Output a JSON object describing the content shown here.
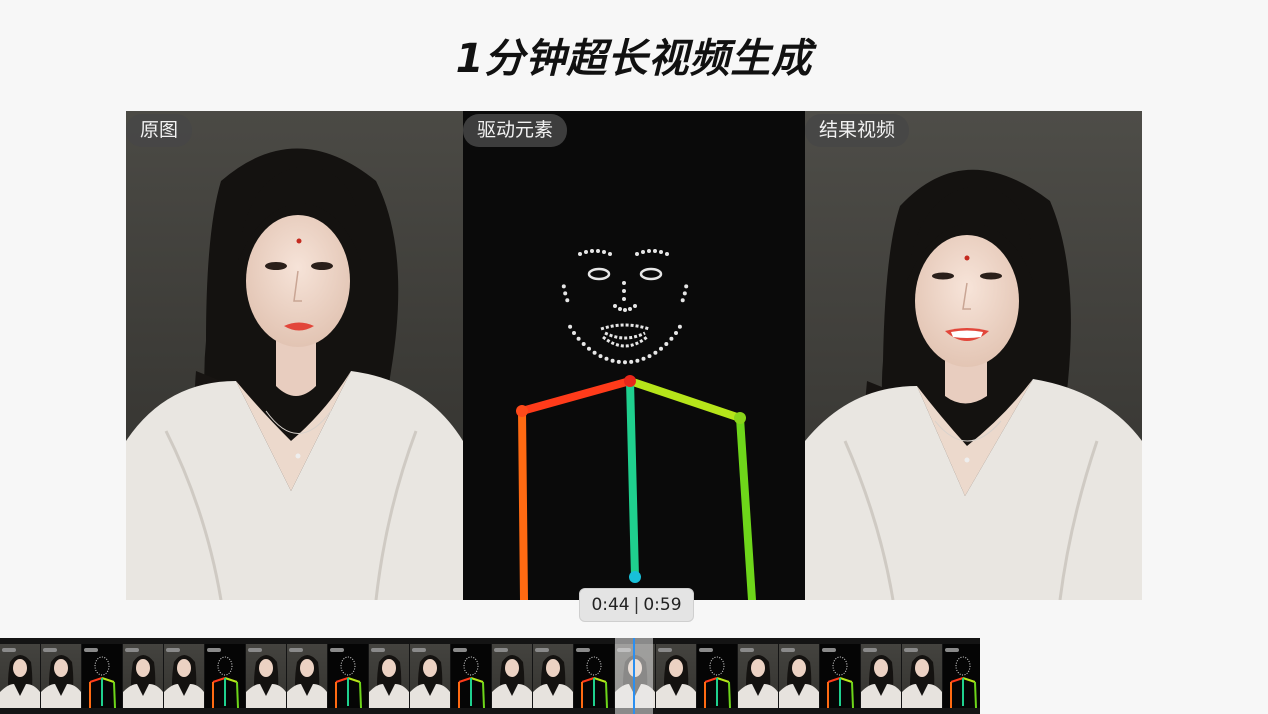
{
  "page": {
    "title": "1分钟超长视频生成"
  },
  "panels": [
    {
      "label": "原图"
    },
    {
      "label": "驱动元素"
    },
    {
      "label": "结果视频"
    }
  ],
  "player": {
    "current_time": "0:44",
    "total_time": "0:59"
  },
  "timeline": {
    "frame_types": [
      "photo",
      "photo",
      "pose",
      "photo",
      "photo",
      "pose",
      "photo",
      "photo",
      "pose",
      "photo",
      "photo",
      "pose",
      "photo",
      "photo",
      "pose",
      "photo",
      "photo",
      "pose",
      "photo",
      "photo",
      "pose",
      "photo",
      "photo",
      "pose"
    ],
    "playhead_color": "#2b8ff0"
  },
  "skeleton_colors": {
    "neck": "#e8271a",
    "left_shoulder": "#ff3b1a",
    "right_shoulder": "#b6e51a",
    "left_arm": "#ff6a12",
    "right_arm": "#6ed61a",
    "spine": "#1fd08e",
    "hip_joint": "#18c0d8"
  }
}
